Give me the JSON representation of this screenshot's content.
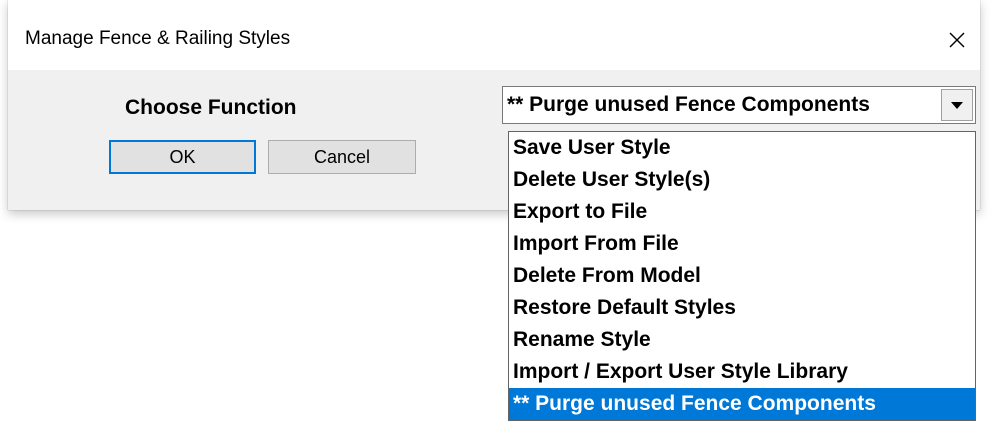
{
  "dialog": {
    "title": "Manage Fence & Railing Styles",
    "close_icon": "close-icon"
  },
  "form": {
    "choose_label": "Choose Function",
    "ok_label": "OK",
    "cancel_label": "Cancel"
  },
  "combo": {
    "selected_value": "** Purge unused Fence Components",
    "arrow_icon": "chevron-down-icon"
  },
  "dropdown": {
    "items": [
      {
        "label": "Save User Style"
      },
      {
        "label": "Delete User Style(s)"
      },
      {
        "label": "Export to File"
      },
      {
        "label": "Import From File"
      },
      {
        "label": "Delete From Model"
      },
      {
        "label": "Restore Default Styles"
      },
      {
        "label": "Rename Style"
      },
      {
        "label": "Import / Export User Style Library"
      },
      {
        "label": "** Purge unused Fence Components"
      }
    ],
    "selected_index": 8
  },
  "colors": {
    "selection": "#0078d7",
    "dialog_bg": "#f0f0f0",
    "button_bg": "#e1e1e1"
  }
}
